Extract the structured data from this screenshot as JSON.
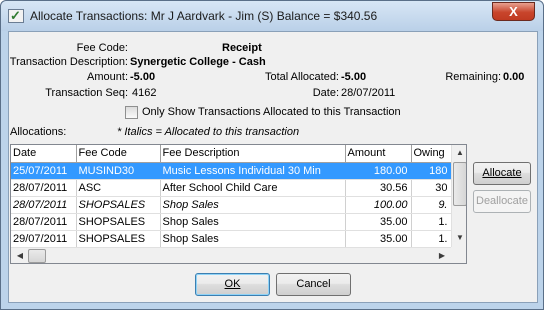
{
  "window": {
    "title": "Allocate Transactions: Mr J Aardvark - Jim (S) Balance = $340.56",
    "close_label": "X"
  },
  "details": {
    "fee_code_label": "Fee Code:",
    "fee_code_value": "Receipt",
    "transaction_description_label": "Transaction Description:",
    "transaction_description_value": "Synergetic College - Cash",
    "amount_label": "Amount:",
    "amount_value": "-5.00",
    "total_allocated_label": "Total Allocated:",
    "total_allocated_value": "-5.00",
    "remaining_label": "Remaining:",
    "remaining_value": "0.00",
    "transaction_seq_label": "Transaction Seq:",
    "transaction_seq_value": "4162",
    "date_label": "Date:",
    "date_value": "28/07/2011"
  },
  "filter": {
    "only_show_label": "Only Show Transactions Allocated to this Transaction",
    "checked": false
  },
  "allocations": {
    "label": "Allocations:",
    "italics_note": "* Italics = Allocated to this transaction",
    "columns": [
      "Date",
      "Fee Code",
      "Fee Description",
      "Amount",
      "Owing"
    ],
    "rows": [
      {
        "date": "25/07/2011",
        "fee_code": "MUSIND30",
        "fee_description": "Music Lessons Individual 30 Min",
        "amount": "180.00",
        "owing": "180",
        "selected": true,
        "italic": false
      },
      {
        "date": "28/07/2011",
        "fee_code": "ASC",
        "fee_description": "After School Child Care",
        "amount": "30.56",
        "owing": "30",
        "selected": false,
        "italic": false
      },
      {
        "date": "28/07/2011",
        "fee_code": "SHOPSALES",
        "fee_description": "Shop Sales",
        "amount": "100.00",
        "owing": "9.",
        "selected": false,
        "italic": true
      },
      {
        "date": "28/07/2011",
        "fee_code": "SHOPSALES",
        "fee_description": "Shop Sales",
        "amount": "35.00",
        "owing": "1.",
        "selected": false,
        "italic": false
      },
      {
        "date": "29/07/2011",
        "fee_code": "SHOPSALES",
        "fee_description": "Shop Sales",
        "amount": "35.00",
        "owing": "1.",
        "selected": false,
        "italic": false
      }
    ]
  },
  "buttons": {
    "allocate": "Allocate",
    "deallocate": "Deallocate",
    "ok": "OK",
    "cancel": "Cancel"
  }
}
